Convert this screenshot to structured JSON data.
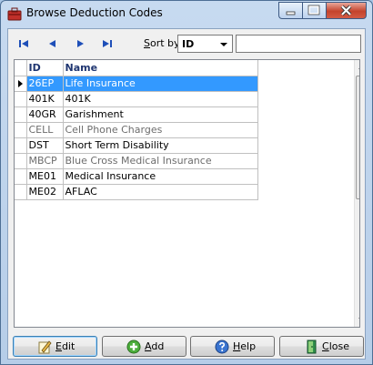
{
  "window": {
    "title": "Browse Deduction Codes",
    "accent": "#3399ff"
  },
  "toolbar": {
    "nav": [
      {
        "name": "first-record-button",
        "icon": "skip-first-icon"
      },
      {
        "name": "previous-record-button",
        "icon": "triangle-left-icon"
      },
      {
        "name": "next-record-button",
        "icon": "triangle-right-icon"
      },
      {
        "name": "last-record-button",
        "icon": "skip-last-icon"
      }
    ],
    "sort_label_accel": "S",
    "sort_label_rest": "ort by",
    "sort_value": "ID",
    "search_value": ""
  },
  "grid": {
    "columns": [
      "ID",
      "Name"
    ],
    "rows": [
      {
        "id": "26EP",
        "name": "Life Insurance",
        "selected": true,
        "inactive": false
      },
      {
        "id": "401K",
        "name": "401K",
        "selected": false,
        "inactive": false
      },
      {
        "id": "40GR",
        "name": "Garishment",
        "selected": false,
        "inactive": false
      },
      {
        "id": "CELL",
        "name": "Cell Phone Charges",
        "selected": false,
        "inactive": true
      },
      {
        "id": "DST",
        "name": "Short Term Disability",
        "selected": false,
        "inactive": false
      },
      {
        "id": "MBCP",
        "name": "Blue Cross Medical Insurance",
        "selected": false,
        "inactive": true
      },
      {
        "id": "ME01",
        "name": "Medical Insurance",
        "selected": false,
        "inactive": false
      },
      {
        "id": "ME02",
        "name": "AFLAC",
        "selected": false,
        "inactive": false
      }
    ]
  },
  "buttons": {
    "edit": {
      "accel": "E",
      "rest": "dit",
      "icon": "edit-pencil-icon"
    },
    "add": {
      "accel": "A",
      "rest": "dd",
      "icon": "plus-circle-icon"
    },
    "help": {
      "accel": "H",
      "rest": "elp",
      "icon": "help-circle-icon"
    },
    "close": {
      "accel": "C",
      "rest": "lose",
      "icon": "door-exit-icon"
    }
  }
}
